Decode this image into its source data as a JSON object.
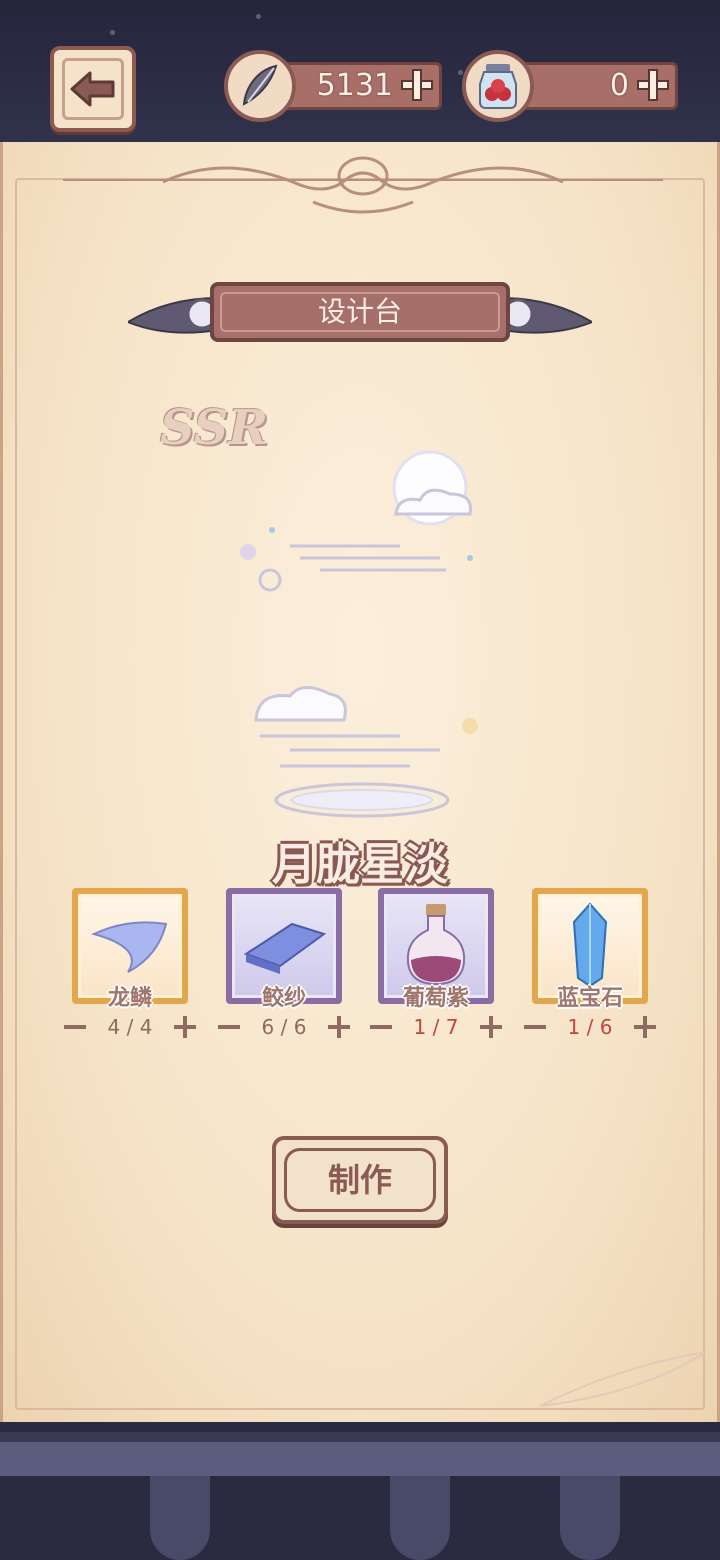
{
  "resources": {
    "feather": {
      "value": "5131"
    },
    "berries": {
      "value": "0"
    }
  },
  "title": "设计台",
  "rarity": "SSR",
  "design_name": "月胧星淡",
  "materials": [
    {
      "name": "龙鳞",
      "count": "4 / 4",
      "frame": "gold",
      "short": false
    },
    {
      "name": "鲛纱",
      "count": "6 / 6",
      "frame": "purple",
      "short": false
    },
    {
      "name": "葡萄紫",
      "count": "1 / 7",
      "frame": "purple",
      "short": true
    },
    {
      "name": "蓝宝石",
      "count": "1 / 6",
      "frame": "gold",
      "short": true
    }
  ],
  "craft_button": "制作",
  "colors": {
    "accent": "#a76f69",
    "gold_frame": "#e2a74d",
    "purple_frame": "#8a6da5",
    "shortage": "#c4453d"
  }
}
